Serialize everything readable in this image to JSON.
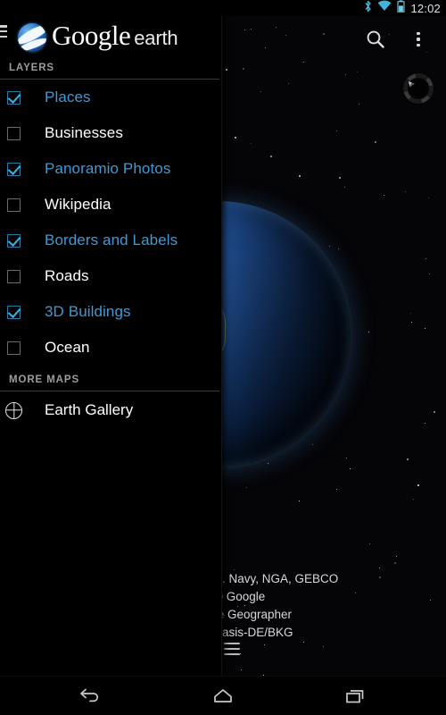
{
  "status_bar": {
    "icons": [
      "bluetooth-icon",
      "wifi-icon",
      "battery-icon"
    ],
    "time": "12:02"
  },
  "action_bar": {
    "menu_icon": "hamburger-icon",
    "logo_icon": "google-earth-globe-icon",
    "brand_primary": "Google",
    "brand_secondary": "earth",
    "search_icon": "search-icon",
    "overflow_icon": "overflow-menu-icon",
    "compass_icon": "compass-icon"
  },
  "drawer": {
    "layers_section_title": "LAYERS",
    "layers": [
      {
        "label": "Places",
        "checked": true
      },
      {
        "label": "Businesses",
        "checked": false
      },
      {
        "label": "Panoramio Photos",
        "checked": true
      },
      {
        "label": "Wikipedia",
        "checked": false
      },
      {
        "label": "Borders and Labels",
        "checked": true
      },
      {
        "label": "Roads",
        "checked": false
      },
      {
        "label": "3D Buildings",
        "checked": true
      },
      {
        "label": "Ocean",
        "checked": false
      }
    ],
    "more_maps_section_title": "MORE MAPS",
    "gallery": {
      "label": "Earth Gallery",
      "icon": "globe-icon"
    }
  },
  "map": {
    "attribution_lines": [
      "S. Navy, NGA, GEBCO",
      "© Google",
      "te Geographer",
      "Basis-DE/BKG"
    ],
    "attribution_menu_icon": "attribution-menu-icon"
  },
  "nav_bar": {
    "back_icon": "back-icon",
    "home_icon": "home-icon",
    "recents_icon": "recents-icon"
  },
  "colors": {
    "accent_blue": "#33b5e5",
    "label_checked": "#3d9ad6",
    "label_unchecked": "#ffffff",
    "background": "#000000",
    "section_header": "#9c9c9c"
  }
}
